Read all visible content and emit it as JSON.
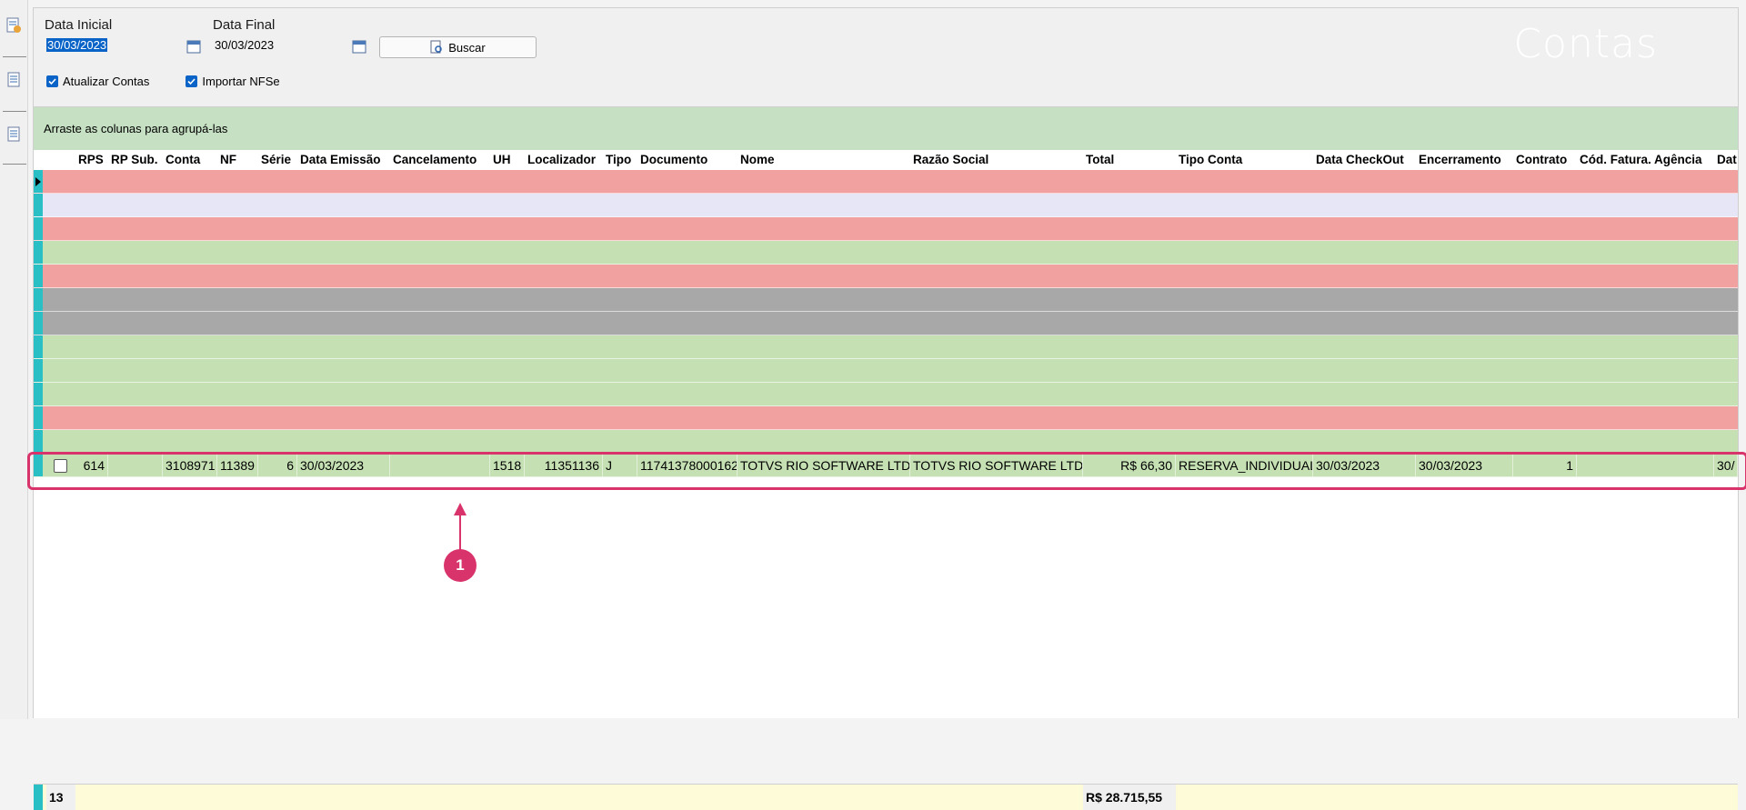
{
  "app": {
    "title": "Contas"
  },
  "filters": {
    "data_inicial_label": "Data Inicial",
    "data_inicial_value": "30/03/2023",
    "data_final_label": "Data Final",
    "data_final_value": "30/03/2023",
    "buscar_label": "Buscar"
  },
  "options": {
    "atualizar_contas": "Atualizar Contas",
    "importar_nfse": "Importar NFSe"
  },
  "grid": {
    "group_hint": "Arraste as colunas para agrupá-las",
    "columns": [
      "RPS",
      "RP Sub.",
      "Conta",
      "NF",
      "Série",
      "Data Emissão",
      "Cancelamento",
      "UH",
      "Localizador",
      "Tipo",
      "Documento",
      "Nome",
      "Razão Social",
      "Total",
      "Tipo Conta",
      "Data CheckOut",
      "Encerramento",
      "Contrato",
      "Cód. Fatura. Agência",
      "Dat"
    ],
    "highlighted_row": {
      "rps": "614",
      "rp_sub": "",
      "conta": "3108971",
      "nf": "11389",
      "serie": "6",
      "data_emissao": "30/03/2023",
      "cancelamento": "",
      "uh": "1518",
      "localizador": "11351136",
      "tipo": "J",
      "documento": "11741378000162",
      "nome": "TOTVS RIO SOFTWARE LTDA",
      "razao_social": "TOTVS RIO SOFTWARE LTDA",
      "total": "R$ 66,30",
      "tipo_conta": "RESERVA_INDIVIDUAL",
      "data_checkout": "30/03/2023",
      "encerramento": "30/03/2023",
      "contrato": "1",
      "cod_fatura": "",
      "dat": "30/"
    },
    "footer": {
      "count": "13",
      "total": "R$ 28.715,55"
    }
  },
  "annotation": {
    "callout_number": "1"
  },
  "colors": {
    "red": "#f0a1a0",
    "green": "#c5e0b3",
    "lavender": "#e6e6f6",
    "grey": "#a8a8a8",
    "accent": "#d9336c",
    "indicator": "#29bfc4"
  }
}
